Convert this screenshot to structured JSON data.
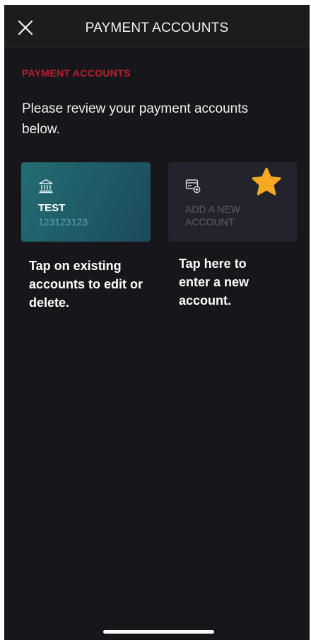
{
  "header": {
    "title": "PAYMENT ACCOUNTS",
    "close_icon": "close-icon"
  },
  "section": {
    "label": "PAYMENT ACCOUNTS",
    "intro": "Please review your payment accounts below."
  },
  "accounts": {
    "existing": {
      "icon": "bank-icon",
      "name": "TEST",
      "number": "123123123"
    },
    "add_new": {
      "icon": "credit-card-add-icon",
      "label": "ADD A NEW ACCOUNT"
    }
  },
  "hints": {
    "existing": "Tap on existing accounts to edit or delete.",
    "add_new": "Tap here to enter a new account."
  },
  "colors": {
    "accent_red": "#b3202e",
    "card_teal": "#246c72",
    "star": "#f7a823",
    "background": "#17171b"
  }
}
